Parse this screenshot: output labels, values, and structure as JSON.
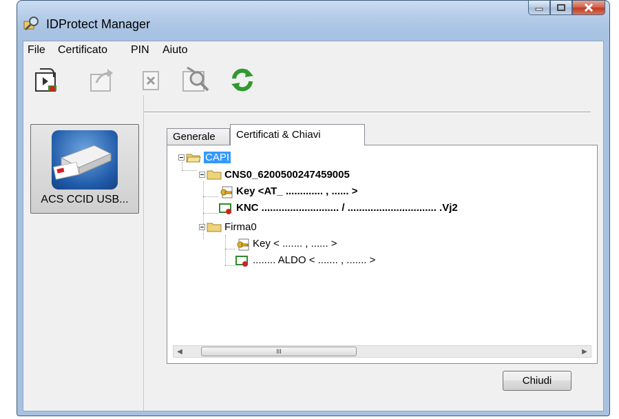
{
  "window": {
    "title": "IDProtect Manager",
    "caption_buttons": [
      "minimize",
      "maximize",
      "close"
    ]
  },
  "menu": {
    "items": [
      "File",
      "Certificato",
      "PIN",
      "Aiuto"
    ]
  },
  "toolbar": {
    "icons": [
      "import-certificate-icon",
      "export-certificate-icon",
      "delete-certificate-icon",
      "view-certificate-icon",
      "refresh-icon"
    ]
  },
  "devices": [
    {
      "label": "ACS CCID USB..."
    }
  ],
  "tabs": [
    {
      "label": "Generale",
      "active": false
    },
    {
      "label": "Certificati & Chiavi",
      "active": true
    }
  ],
  "tree": {
    "root": "CAPI",
    "containers": [
      {
        "name": "CNS0_6200500247459005",
        "key": "Key  <AT_ ............. , ......    >",
        "certificate": "KNC ...........................     /     ...............................        .Vj2"
      },
      {
        "name": "Firma0",
        "key": "Key  < ....... , ...... >",
        "certificate": "........ ALDO < ....... , ....... >"
      }
    ]
  },
  "scrollbar": {
    "thumb_grip": "III"
  },
  "buttons": {
    "close_label": "Chiudi"
  },
  "colors": {
    "selection": "#3399ff",
    "title_bar": "#b6cde9",
    "close_button": "#c23a1e"
  }
}
